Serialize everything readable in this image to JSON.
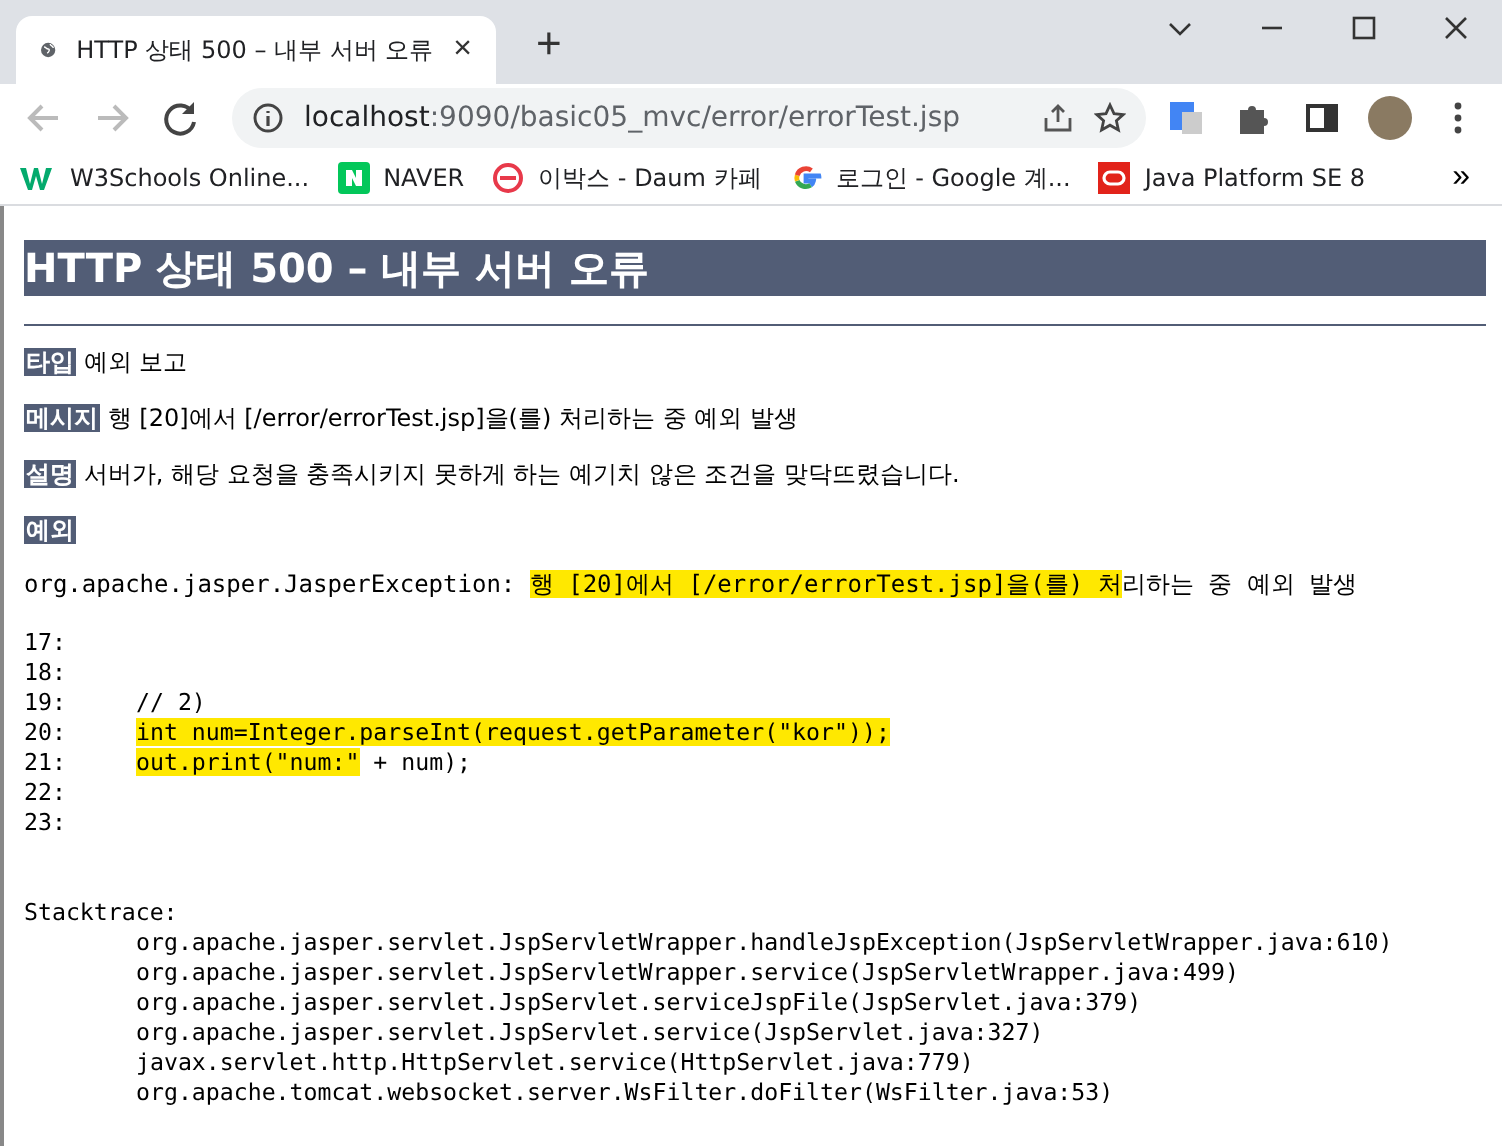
{
  "tab": {
    "title": "HTTP 상태 500 – 내부 서버 오류",
    "close": "×",
    "new_tab": "+"
  },
  "address_bar": {
    "host": "localhost",
    "path": ":9090/basic05_mvc/error/errorTest.jsp"
  },
  "bookmarks": [
    {
      "label": "W3Schools Online..."
    },
    {
      "label": "NAVER"
    },
    {
      "label": "이박스 - Daum 카페"
    },
    {
      "label": "로그인 - Google 계..."
    },
    {
      "label": "Java Platform SE 8"
    }
  ],
  "bookmarks_more": "»",
  "page": {
    "title": "HTTP 상태 500 – 내부 서버 오류",
    "fields": [
      {
        "label": "타입",
        "value": "예외 보고"
      },
      {
        "label": "메시지",
        "value": "행 [20]에서 [/error/errorTest.jsp]을(를) 처리하는 중 예외 발생"
      },
      {
        "label": "설명",
        "value": "서버가, 해당 요청을 충족시키지 못하게 하는 예기치 않은 조건을 맞닥뜨렸습니다."
      }
    ],
    "exception_label": "예외",
    "exception": {
      "class": "org.apache.jasper.JasperException:",
      "message": [
        {
          "text": "행 [20]에서 [/error/errorTest.jsp]을(를) 처",
          "highlighted": true
        },
        {
          "text": "리하는 중 예외 발생",
          "highlighted": false
        }
      ]
    },
    "code_lines": [
      {
        "number": "17:"
      },
      {
        "number": "18:"
      },
      {
        "number": "19:",
        "code": [
          {
            "text": "// 2)",
            "highlighted": false
          }
        ]
      },
      {
        "number": "20:",
        "code": [
          {
            "text": "int num=Integer.parseInt(request.getParameter(\"kor\"));",
            "highlighted": true
          }
        ]
      },
      {
        "number": "21:",
        "code": [
          {
            "text": "out.print(\"num:\"",
            "highlighted": true
          },
          {
            "text": " + num);",
            "highlighted": false
          }
        ]
      },
      {
        "number": "22:"
      },
      {
        "number": "23:"
      }
    ],
    "stacktrace_label": "Stacktrace:",
    "stacktrace": [
      "org.apache.jasper.servlet.JspServletWrapper.handleJspException(JspServletWrapper.java:610)",
      "org.apache.jasper.servlet.JspServletWrapper.service(JspServletWrapper.java:499)",
      "org.apache.jasper.servlet.JspServlet.serviceJspFile(JspServlet.java:379)",
      "org.apache.jasper.servlet.JspServlet.service(JspServlet.java:327)",
      "javax.servlet.http.HttpServlet.service(HttpServlet.java:779)",
      "org.apache.tomcat.websocket.server.WsFilter.doFilter(WsFilter.java:53)"
    ]
  }
}
